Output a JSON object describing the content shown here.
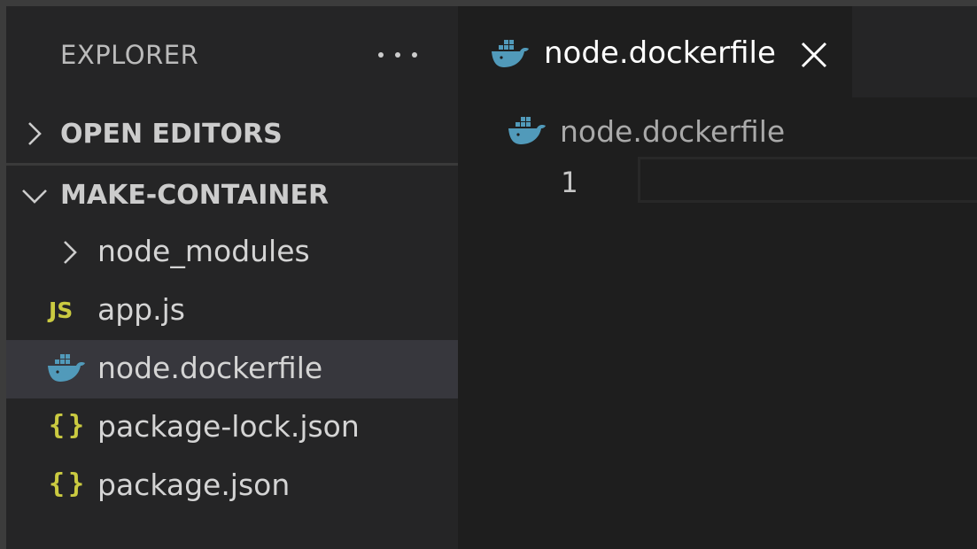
{
  "sidebar": {
    "title": "EXPLORER",
    "open_editors": "OPEN EDITORS",
    "folder": "MAKE-CONTAINER",
    "items": [
      {
        "label": "node_modules",
        "icon": "chevron-right-icon"
      },
      {
        "label": "app.js",
        "icon": "js-icon",
        "icon_text": "JS"
      },
      {
        "label": "node.dockerfile",
        "icon": "docker-icon",
        "selected": true
      },
      {
        "label": "package-lock.json",
        "icon": "json-icon",
        "icon_text": "{}"
      },
      {
        "label": "package.json",
        "icon": "json-icon",
        "icon_text": "{}"
      }
    ]
  },
  "editor": {
    "tab": {
      "label": "node.dockerfile",
      "icon": "docker-icon",
      "close_icon": "close-icon"
    },
    "breadcrumb": {
      "label": "node.dockerfile",
      "icon": "docker-icon"
    },
    "line_numbers": [
      "1"
    ]
  },
  "colors": {
    "docker_blue": "#519aba",
    "json_yellow": "#cbcb41",
    "selection": "#37373d"
  }
}
